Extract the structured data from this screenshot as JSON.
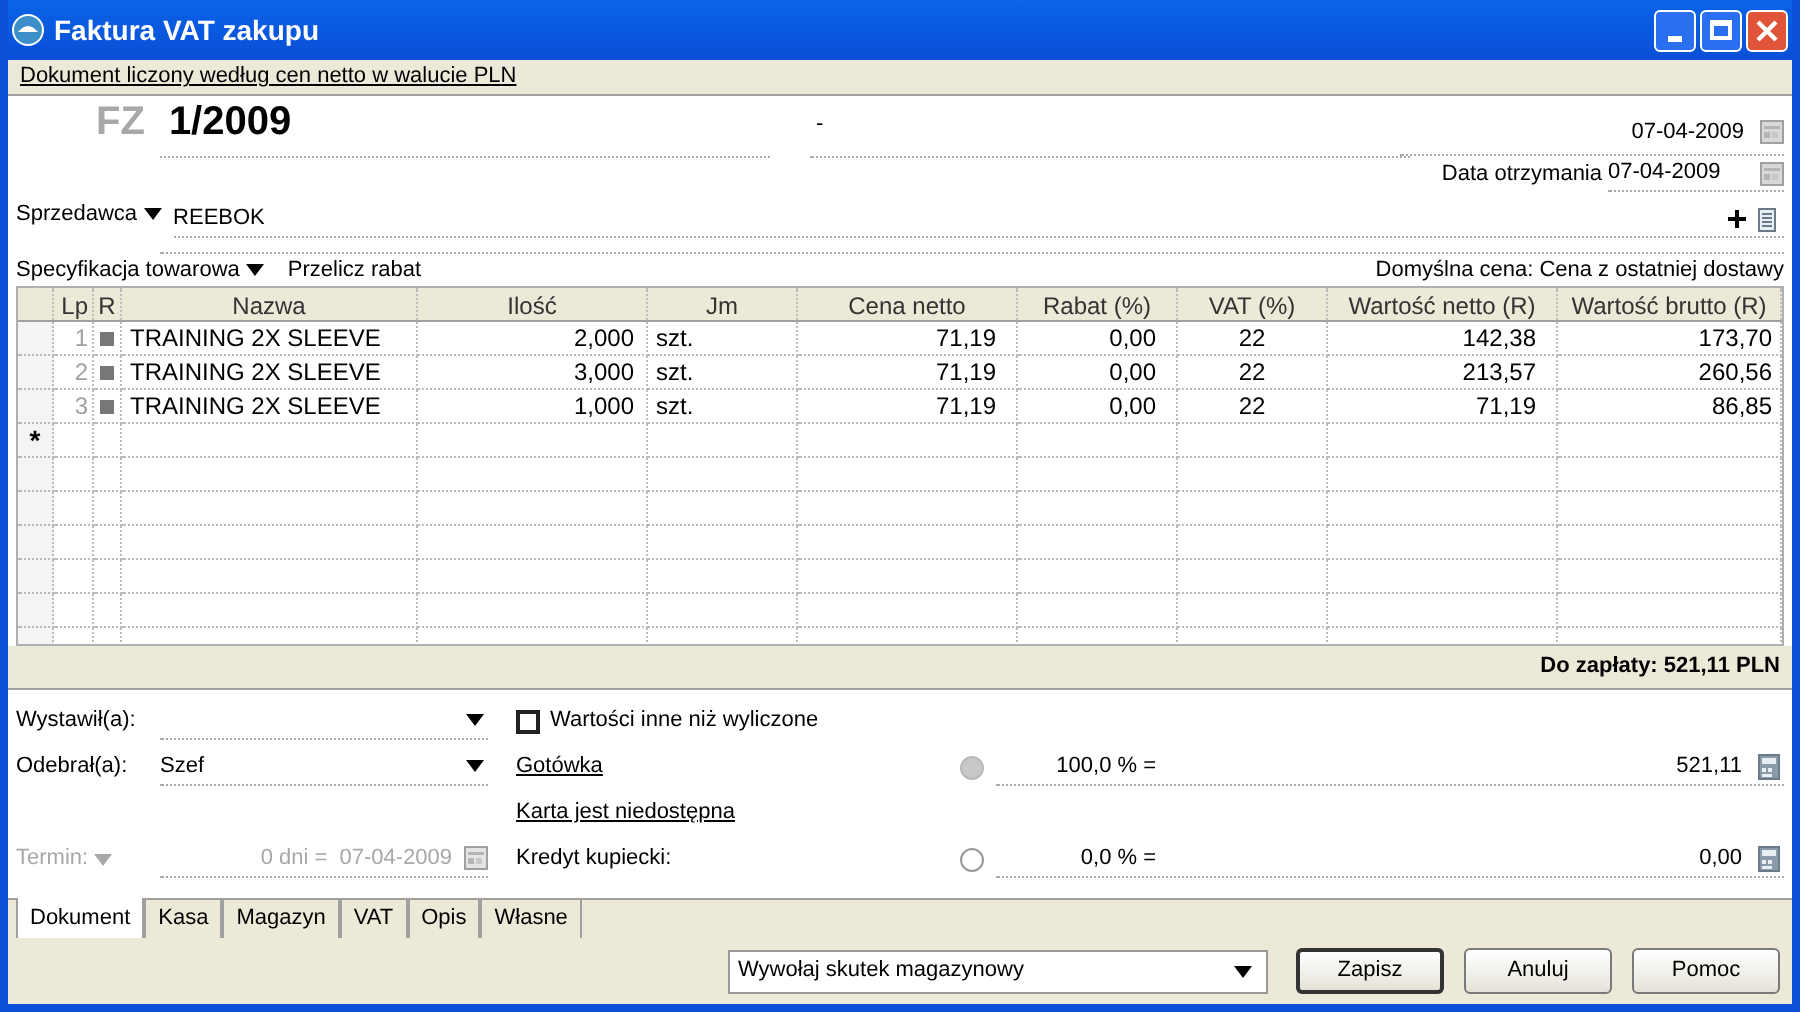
{
  "window": {
    "title": "Faktura VAT zakupu"
  },
  "info_bar": "Dokument liczony według cen netto w walucie PLN",
  "document": {
    "prefix": "FZ",
    "number": "1/2009",
    "separator": "-",
    "date": "07-04-2009",
    "received_label": "Data otrzymania",
    "received_date": "07-04-2009"
  },
  "seller": {
    "label": "Sprzedawca",
    "value": "REEBOK"
  },
  "spec": {
    "label": "Specyfikacja towarowa",
    "recalc": "Przelicz rabat",
    "default_price": "Domyślna cena: Cena z ostatniej dostawy"
  },
  "table": {
    "columns": [
      "Lp",
      "R",
      "Nazwa",
      "Ilość",
      "Jm",
      "Cena netto",
      "Rabat (%)",
      "VAT (%)",
      "Wartość netto (R)",
      "Wartość brutto (R)"
    ],
    "rows": [
      {
        "lp": "1",
        "name": "TRAINING 2X SLEEVE",
        "qty": "2,000",
        "unit": "szt.",
        "price": "71,19",
        "discount": "0,00",
        "vat": "22",
        "net": "142,38",
        "gross": "173,70"
      },
      {
        "lp": "2",
        "name": "TRAINING 2X SLEEVE",
        "qty": "3,000",
        "unit": "szt.",
        "price": "71,19",
        "discount": "0,00",
        "vat": "22",
        "net": "213,57",
        "gross": "260,56"
      },
      {
        "lp": "3",
        "name": "TRAINING 2X SLEEVE",
        "qty": "1,000",
        "unit": "szt.",
        "price": "71,19",
        "discount": "0,00",
        "vat": "22",
        "net": "71,19",
        "gross": "86,85"
      }
    ],
    "new_row_marker": "*"
  },
  "total": "Do zapłaty: 521,11 PLN",
  "issued_by": {
    "label": "Wystawił(a):"
  },
  "received_by": {
    "label": "Odebrał(a):",
    "value": "Szef"
  },
  "term": {
    "label": "Termin:",
    "days": "0 dni =",
    "date": "07-04-2009",
    "disabled": true
  },
  "other_values": {
    "label": "Wartości inne niż wyliczone",
    "checked": false
  },
  "payments": [
    {
      "kind": "method",
      "label": "Gotówka",
      "link": true,
      "selected": true,
      "percent": "100,0 % =",
      "amount": "521,11"
    },
    {
      "kind": "note",
      "label": "Karta jest niedostępna"
    },
    {
      "kind": "method",
      "label": "Kredyt kupiecki:",
      "link": false,
      "selected": false,
      "percent": "0,0 % =",
      "amount": "0,00"
    }
  ],
  "tabs": [
    {
      "label": "Dokument",
      "selected": true
    },
    {
      "label": "Kasa",
      "selected": false
    },
    {
      "label": "Magazyn",
      "selected": false
    },
    {
      "label": "VAT",
      "selected": false
    },
    {
      "label": "Opis",
      "selected": false
    },
    {
      "label": "Własne",
      "selected": false
    }
  ],
  "action": {
    "value": "Wywołaj skutek magazynowy"
  },
  "buttons": [
    {
      "label": "Zapisz",
      "default": true
    },
    {
      "label": "Anuluj",
      "default": false
    },
    {
      "label": "Pomoc",
      "default": false
    }
  ]
}
